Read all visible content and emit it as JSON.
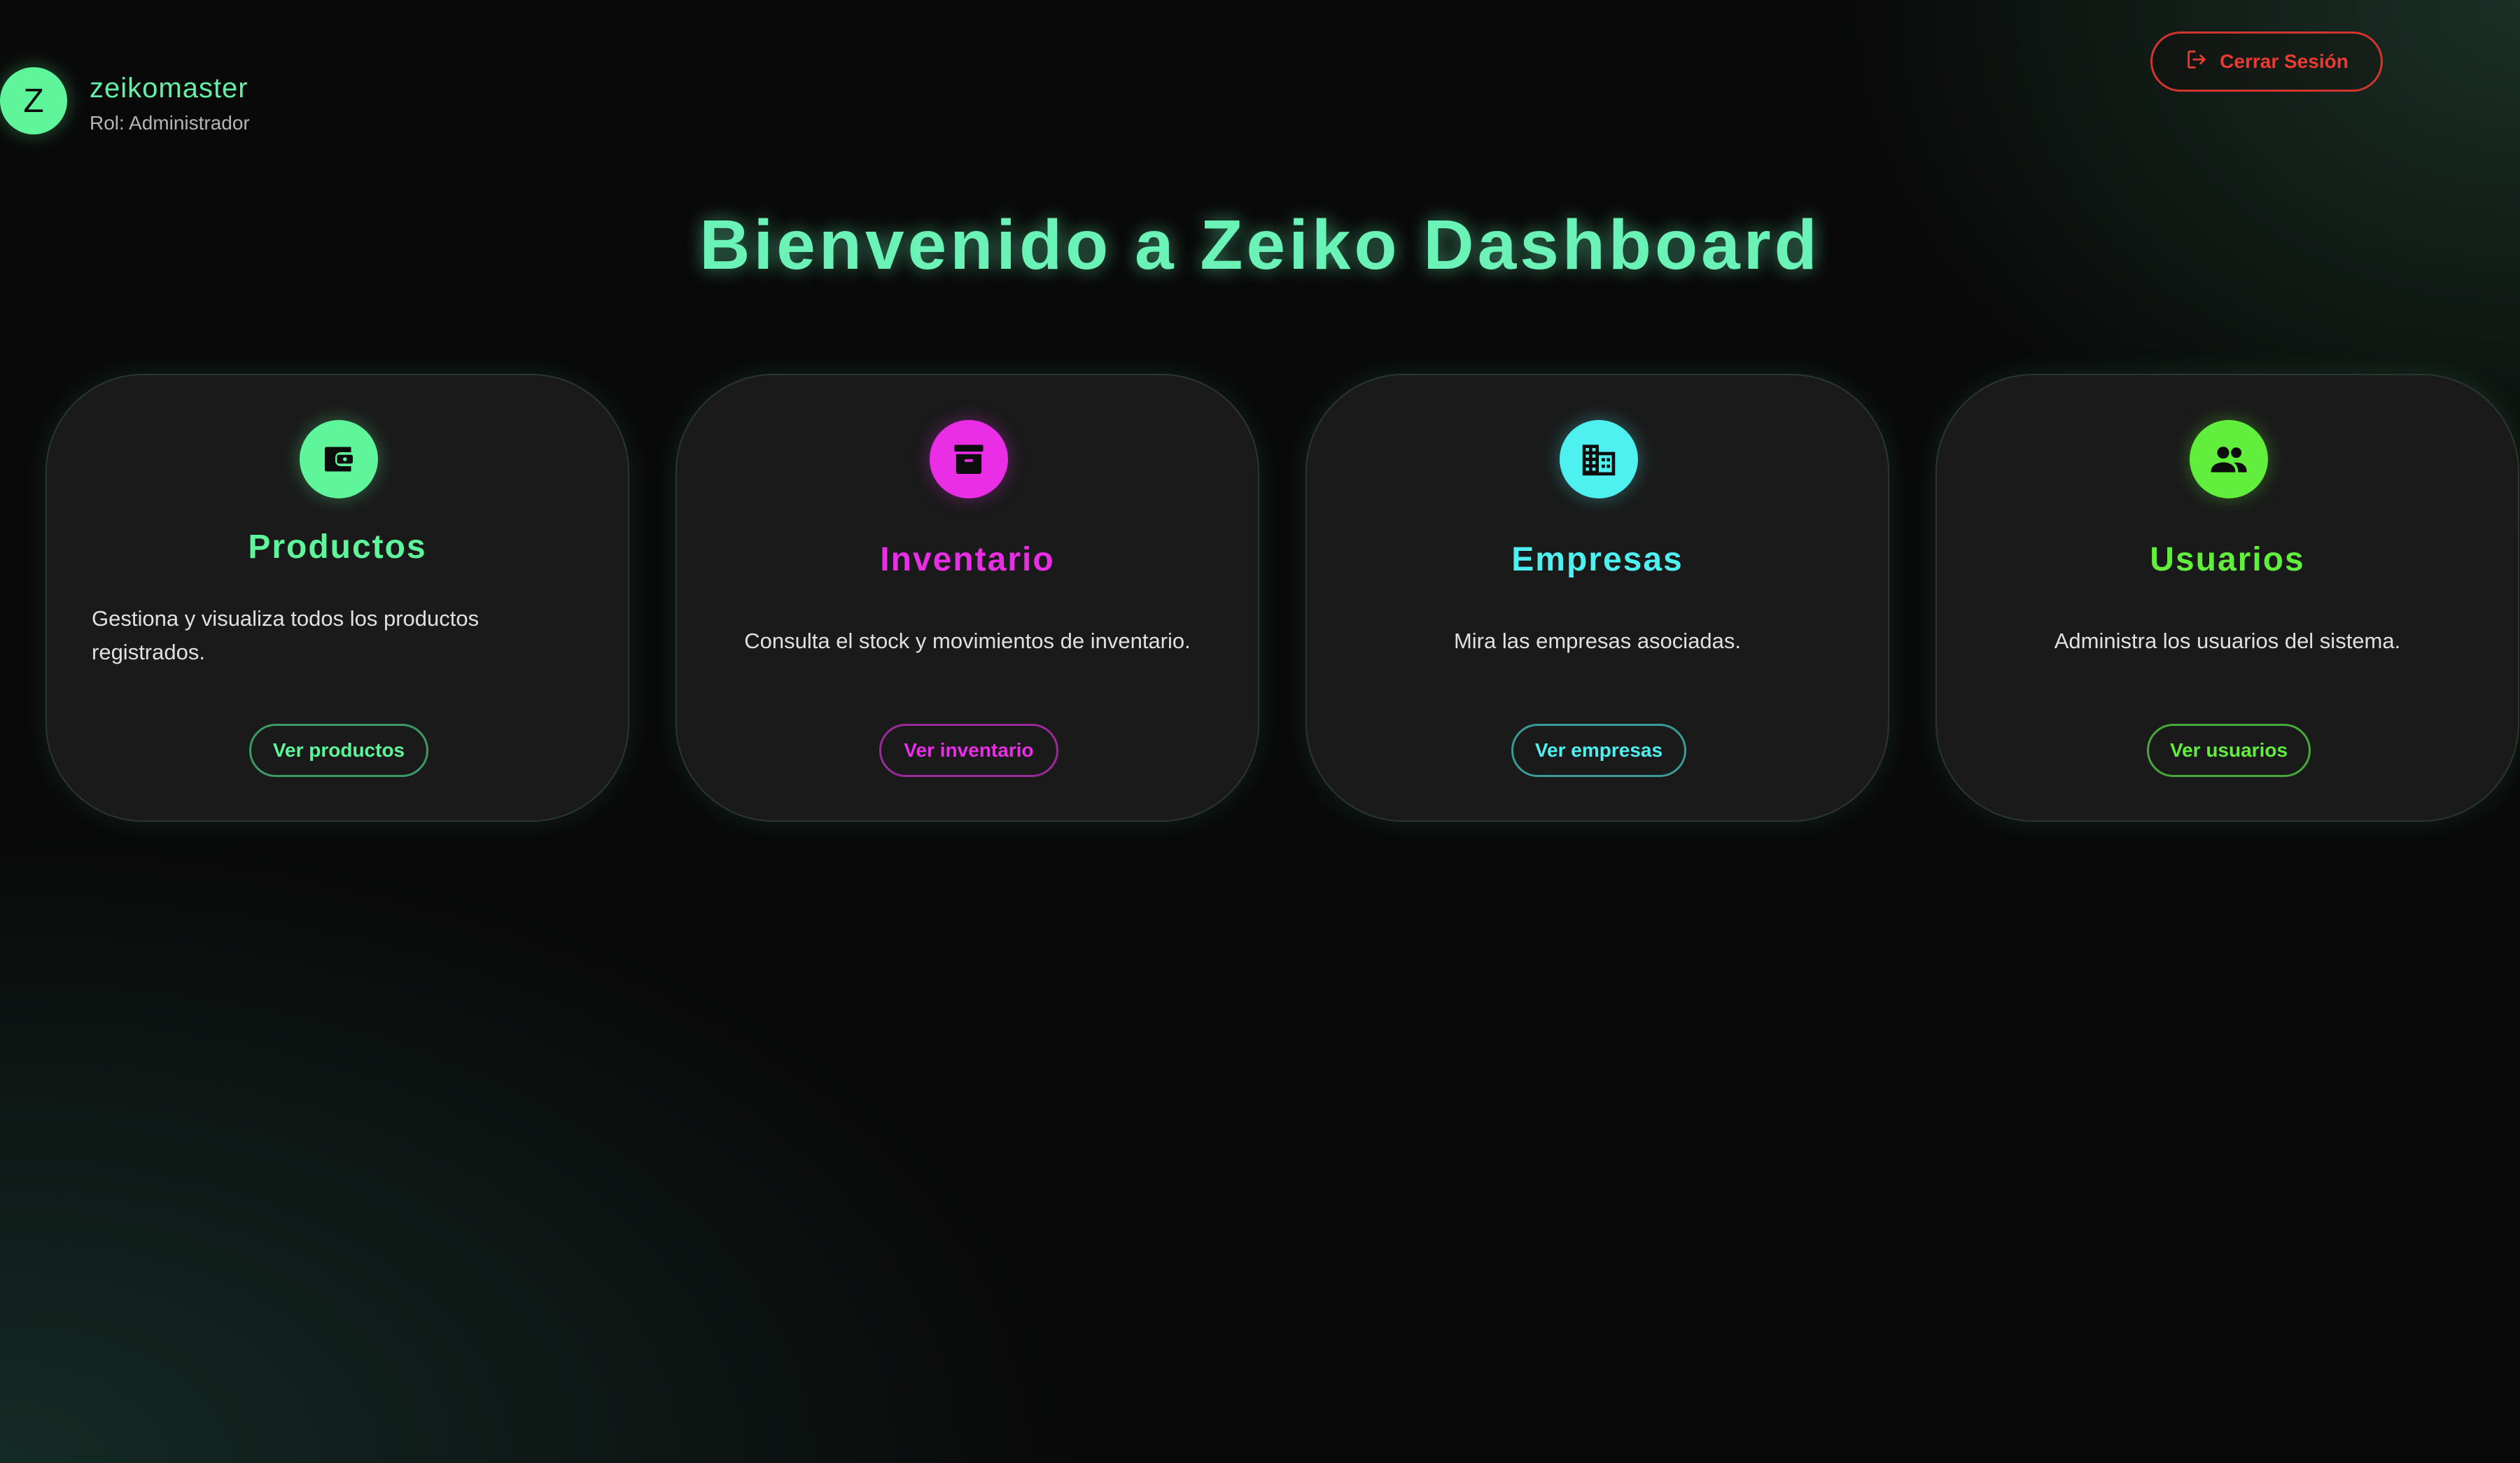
{
  "user": {
    "initial": "Z",
    "name": "zeikomaster",
    "role": "Rol: Administrador"
  },
  "header": {
    "logout_label": "Cerrar Sesión",
    "logout_icon": "logout-icon"
  },
  "page": {
    "title": "Bienvenido a Zeiko Dashboard"
  },
  "cards": [
    {
      "id": "productos",
      "title": "Productos",
      "description": "Gestiona y visualiza todos los productos registrados.",
      "button_label": "Ver productos",
      "icon": "wallet-icon",
      "color": "#5ef59b"
    },
    {
      "id": "inventario",
      "title": "Inventario",
      "description": "Consulta el stock y movimientos de inventario.",
      "button_label": "Ver inventario",
      "icon": "archive-box-icon",
      "color": "#e92ee6"
    },
    {
      "id": "empresas",
      "title": "Empresas",
      "description": "Mira las empresas asociadas.",
      "button_label": "Ver empresas",
      "icon": "building-icon",
      "color": "#4ff0f0"
    },
    {
      "id": "usuarios",
      "title": "Usuarios",
      "description": "Administra los usuarios del sistema.",
      "button_label": "Ver usuarios",
      "icon": "users-icon",
      "color": "#62ee3c"
    }
  ],
  "colors": {
    "background": "#090909",
    "card_background": "#1a1a1a",
    "title": "#6bf2b6",
    "logout": "#ea3b33"
  }
}
